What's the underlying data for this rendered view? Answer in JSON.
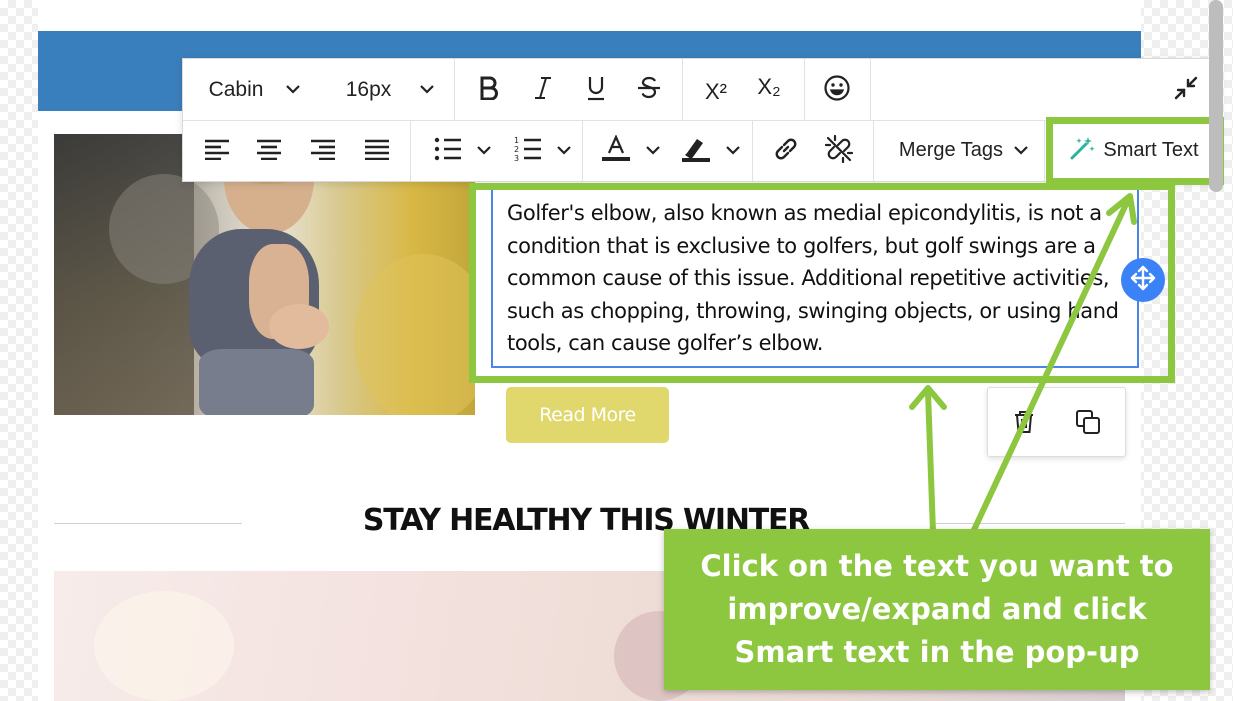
{
  "toolbar": {
    "font_family": "Cabin",
    "font_size": "16px",
    "merge_tags_label": "Merge Tags",
    "smart_text_label": "Smart Text",
    "superscript_label": "X²",
    "subscript_label": "X₂"
  },
  "content": {
    "paragraph": "Golfer's elbow, also known as medial epicondylitis, is not a condition that is exclusive to golfers, but golf swings are a common cause of this issue. Additional repetitive activities, such as chopping, throwing, swinging objects, or using hand tools, can cause golfer’s elbow.",
    "read_more_label": "Read More",
    "section_title": "STAY HEALTHY THIS WINTER"
  },
  "callout": {
    "text": "Click on the text you want to improve/expand and click Smart text in the pop-up"
  },
  "colors": {
    "header_blue": "#3a7fbd",
    "highlight_green": "#8dc63f",
    "read_more_bg": "#e0d86c",
    "selection_blue": "#4a86e8"
  },
  "icons": {
    "bold": "bold-icon",
    "italic": "italic-icon",
    "underline": "underline-icon",
    "strikethrough": "strikethrough-icon",
    "emoji": "smiley-icon",
    "collapse": "collapse-icon",
    "link": "link-icon",
    "unlink": "unlink-icon",
    "move": "move-icon",
    "delete": "trash-icon",
    "duplicate": "duplicate-icon",
    "smart_text": "magic-wand-icon"
  }
}
